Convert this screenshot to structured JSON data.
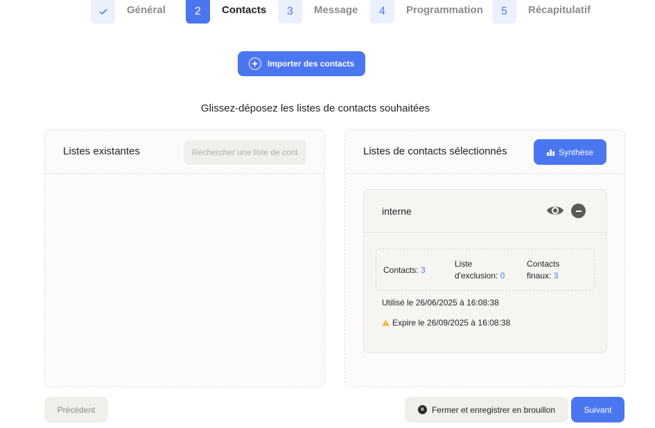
{
  "stepper": {
    "steps": [
      {
        "number": "",
        "icon": "check-icon",
        "label": "Général",
        "state": "done"
      },
      {
        "number": "2",
        "label": "Contacts",
        "state": "active"
      },
      {
        "number": "3",
        "label": "Message",
        "state": "pending"
      },
      {
        "number": "4",
        "label": "Programmation",
        "state": "pending"
      },
      {
        "number": "5",
        "label": "Récapitulatif",
        "state": "pending"
      }
    ]
  },
  "import_button": {
    "label": "Importer des contacts",
    "icon": "plus-circle-icon"
  },
  "instruction": "Glissez-déposez les listes de contacts souhaitées",
  "existing_lists": {
    "title": "Listes existantes",
    "search_placeholder": "Rechercher une liste de contacts"
  },
  "selected_lists": {
    "title": "Listes de contacts sélectionnés",
    "synthese_label": "Synthèse",
    "items": [
      {
        "name": "interne",
        "contacts_label": "Contacts:",
        "contacts_value": "3",
        "exclusion_label": "Liste d'exclusion:",
        "exclusion_value": "0",
        "final_label": "Contacts finaux:",
        "final_value": "3",
        "used_prefix": "Utilisé le",
        "used_date": "26/06/2025 à 16:08:38",
        "expire_prefix": "Expire le",
        "expire_date": "26/09/2025 à 16:08:38"
      }
    ]
  },
  "footer": {
    "prev_label": "Précédent",
    "close_label": "Fermer et enregistrer en brouillon",
    "next_label": "Suivant"
  },
  "colors": {
    "accent": "#4a76f0",
    "accent_light": "#eaf1fd",
    "warning": "#e9b320",
    "neutral_button": "#f1efec"
  }
}
